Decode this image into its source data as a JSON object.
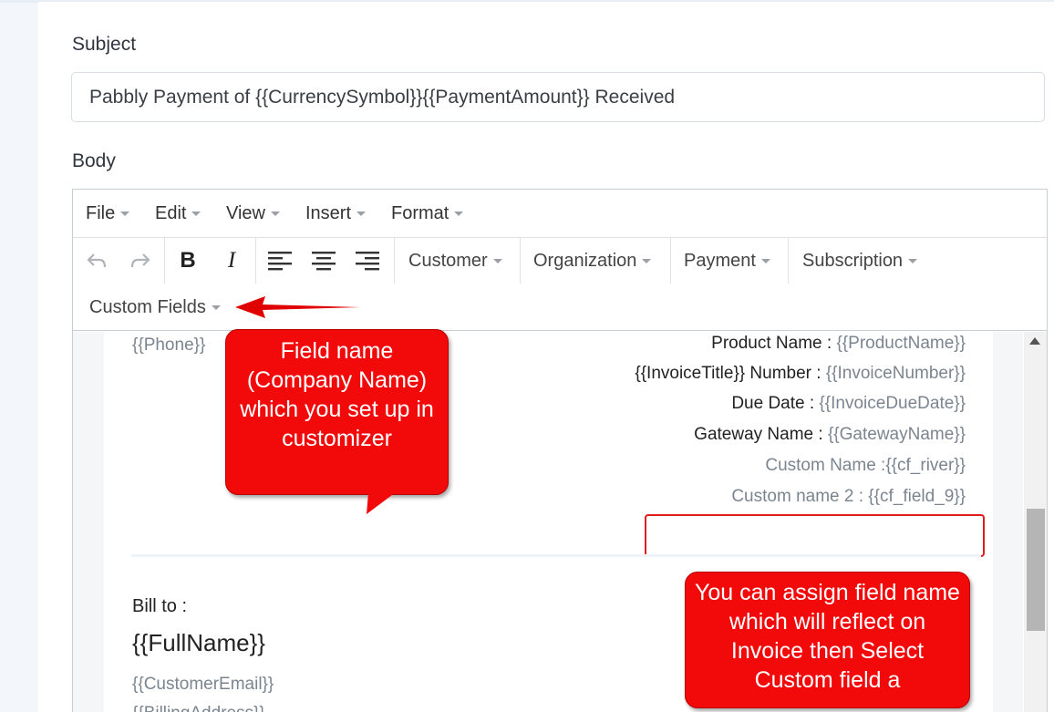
{
  "subject": {
    "label": "Subject",
    "value": "Pabbly Payment of {{CurrencySymbol}}{{PaymentAmount}} Received"
  },
  "body": {
    "label": "Body"
  },
  "menubar": {
    "items": [
      {
        "label": "File"
      },
      {
        "label": "Edit"
      },
      {
        "label": "View"
      },
      {
        "label": "Insert"
      },
      {
        "label": "Format"
      }
    ]
  },
  "toolbar": {
    "icons": [
      "undo-icon",
      "redo-icon",
      "bold-icon",
      "italic-icon",
      "align-left-icon",
      "align-center-icon",
      "align-right-icon"
    ],
    "bold": "B",
    "italic": "I",
    "dropdowns": [
      {
        "label": "Customer"
      },
      {
        "label": "Organization"
      },
      {
        "label": "Payment"
      },
      {
        "label": "Subscription"
      },
      {
        "label": "Custom Fields"
      }
    ]
  },
  "content": {
    "phone": "{{Phone}}",
    "details": [
      {
        "label": "Product Name : ",
        "value": "{{ProductName}}"
      },
      {
        "label": "{{InvoiceTitle}} Number : ",
        "value": "{{InvoiceNumber}}"
      },
      {
        "label": "Due Date : ",
        "value": "{{InvoiceDueDate}}"
      },
      {
        "label": "Gateway Name : ",
        "value": "{{GatewayName}}"
      },
      {
        "label": "Custom Name :",
        "value": "{{cf_river}}"
      },
      {
        "label": "Custom name 2 : ",
        "value": "{{cf_field_9}}"
      }
    ],
    "bill_to_label": "Bill to :",
    "full_name": "{{FullName}}",
    "customer_email": "{{CustomerEmail}}",
    "billing_address": "{{BillingAddress}}"
  },
  "callouts": {
    "field_name": "Field name (Company Name) which you set up in customizer",
    "assign": "You can assign field name which will reflect on Invoice then Select  Custom  field a"
  },
  "colors": {
    "callout_red": "#f20a0a",
    "arrow_red": "#e00000",
    "placeholder_gray": "#7b8590"
  }
}
